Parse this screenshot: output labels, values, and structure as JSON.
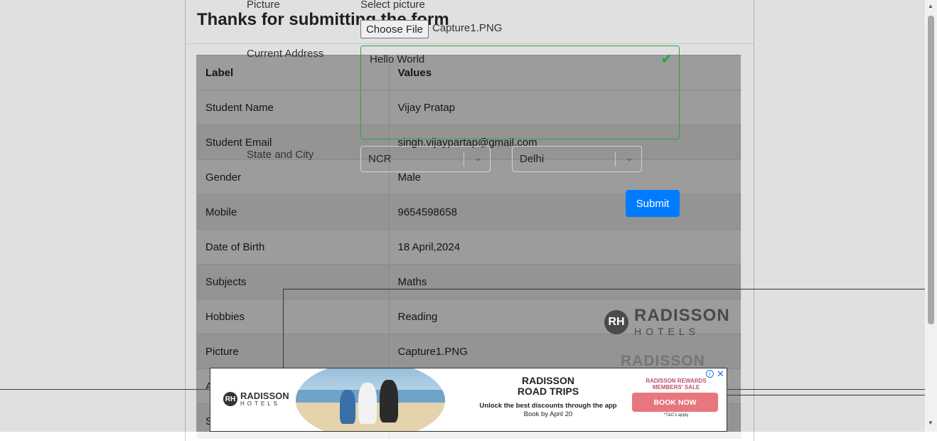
{
  "form": {
    "picture_label": "Picture",
    "select_picture_label": "Select picture",
    "choose_file_label": "Choose File",
    "file_name": "Capture1.PNG",
    "address_label": "Current Address",
    "address_value": "Hello World",
    "state_city_label": "State and City",
    "state_value": "NCR",
    "city_value": "Delhi",
    "submit_label": "Submit"
  },
  "modal": {
    "title": "Thanks for submitting the form",
    "table": {
      "headers": [
        "Label",
        "Values"
      ],
      "rows": [
        [
          "Student Name",
          "Vijay Pratap"
        ],
        [
          "Student Email",
          "singh.vijaypartap@gmail.com"
        ],
        [
          "Gender",
          "Male"
        ],
        [
          "Mobile",
          "9654598658"
        ],
        [
          "Date of Birth",
          "18 April,2024"
        ],
        [
          "Subjects",
          "Maths"
        ],
        [
          "Hobbies",
          "Reading"
        ],
        [
          "Picture",
          "Capture1.PNG"
        ],
        [
          "A",
          ""
        ],
        [
          "S",
          ""
        ]
      ]
    }
  },
  "ad_big": {
    "brand_line1": "RADISSON",
    "brand_line2": "HOTELS",
    "brand_faded": "RADISSON"
  },
  "ad": {
    "brand_line1": "RADISSON",
    "brand_line2": "HOTELS",
    "headline_1": "RADISSON",
    "headline_2": "ROAD TRIPS",
    "subline": "Unlock the best discounts through the app",
    "subline2": "Book by April 20",
    "promo_1": "RADISSON REWARDS",
    "promo_2": "MEMBERS' SALE",
    "cta": "BOOK NOW",
    "terms": "*T&C's apply",
    "info_icon": "i",
    "close_icon": "✕"
  },
  "colors": {
    "submit": "#007bff",
    "valid": "#28a745",
    "book_now": "#e8767e"
  }
}
